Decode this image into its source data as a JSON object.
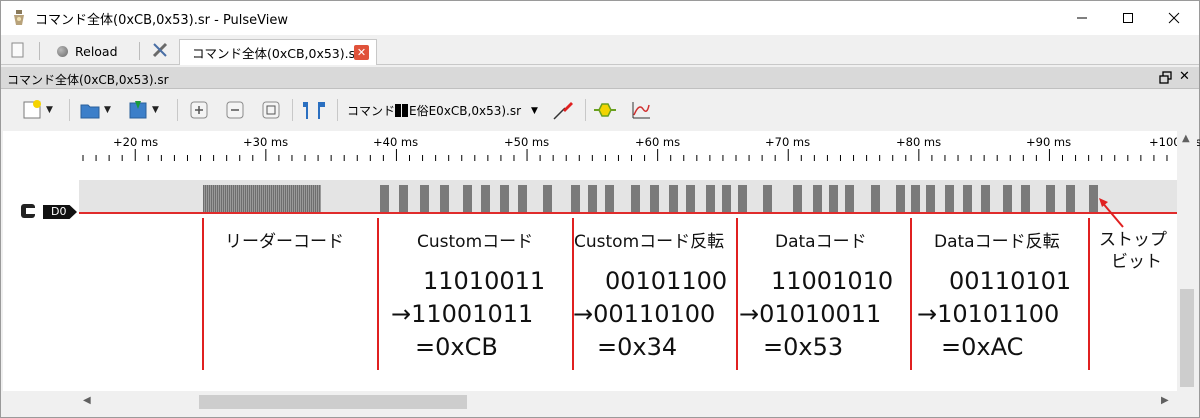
{
  "window": {
    "title": "コマンド全体(0xCB,0x53).sr - PulseView"
  },
  "tabbar": {
    "reload_label": "Reload",
    "tab_label": "コマンド全体(0xCB,0x53).sr",
    "tab_close": "✕"
  },
  "dock": {
    "title": "コマンド全体(0xCB,0x53).sr",
    "close_glyph": "✕"
  },
  "toolbar": {
    "file_combo_prefix": "コマンド",
    "file_combo_suffix": "E俗E0xCB,0x53).sr"
  },
  "ruler": {
    "ticks": [
      "+20 ms",
      "+30 ms",
      "+40 ms",
      "+50 ms",
      "+60 ms",
      "+70 ms",
      "+80 ms",
      "+90 ms",
      "+100 ms"
    ]
  },
  "channel": {
    "name": "D0",
    "trace_color": "#e02b2b"
  },
  "annotations": {
    "segments": [
      {
        "heading": "リーダーコード",
        "bits": []
      },
      {
        "heading": "Customコード",
        "bits": [
          "11010011",
          "→11001011",
          "=0xCB"
        ]
      },
      {
        "heading": "Customコード反転",
        "bits": [
          "00101100",
          "→00110100",
          "=0x34"
        ]
      },
      {
        "heading": "Dataコード",
        "bits": [
          "11001010",
          "→01010011",
          "=0x53"
        ]
      },
      {
        "heading": "Dataコード反転",
        "bits": [
          "00110101",
          "→10101100",
          "=0xAC"
        ]
      }
    ],
    "stop_bit": [
      "ストップ",
      "ビット"
    ],
    "marker_color": "#e02020"
  }
}
